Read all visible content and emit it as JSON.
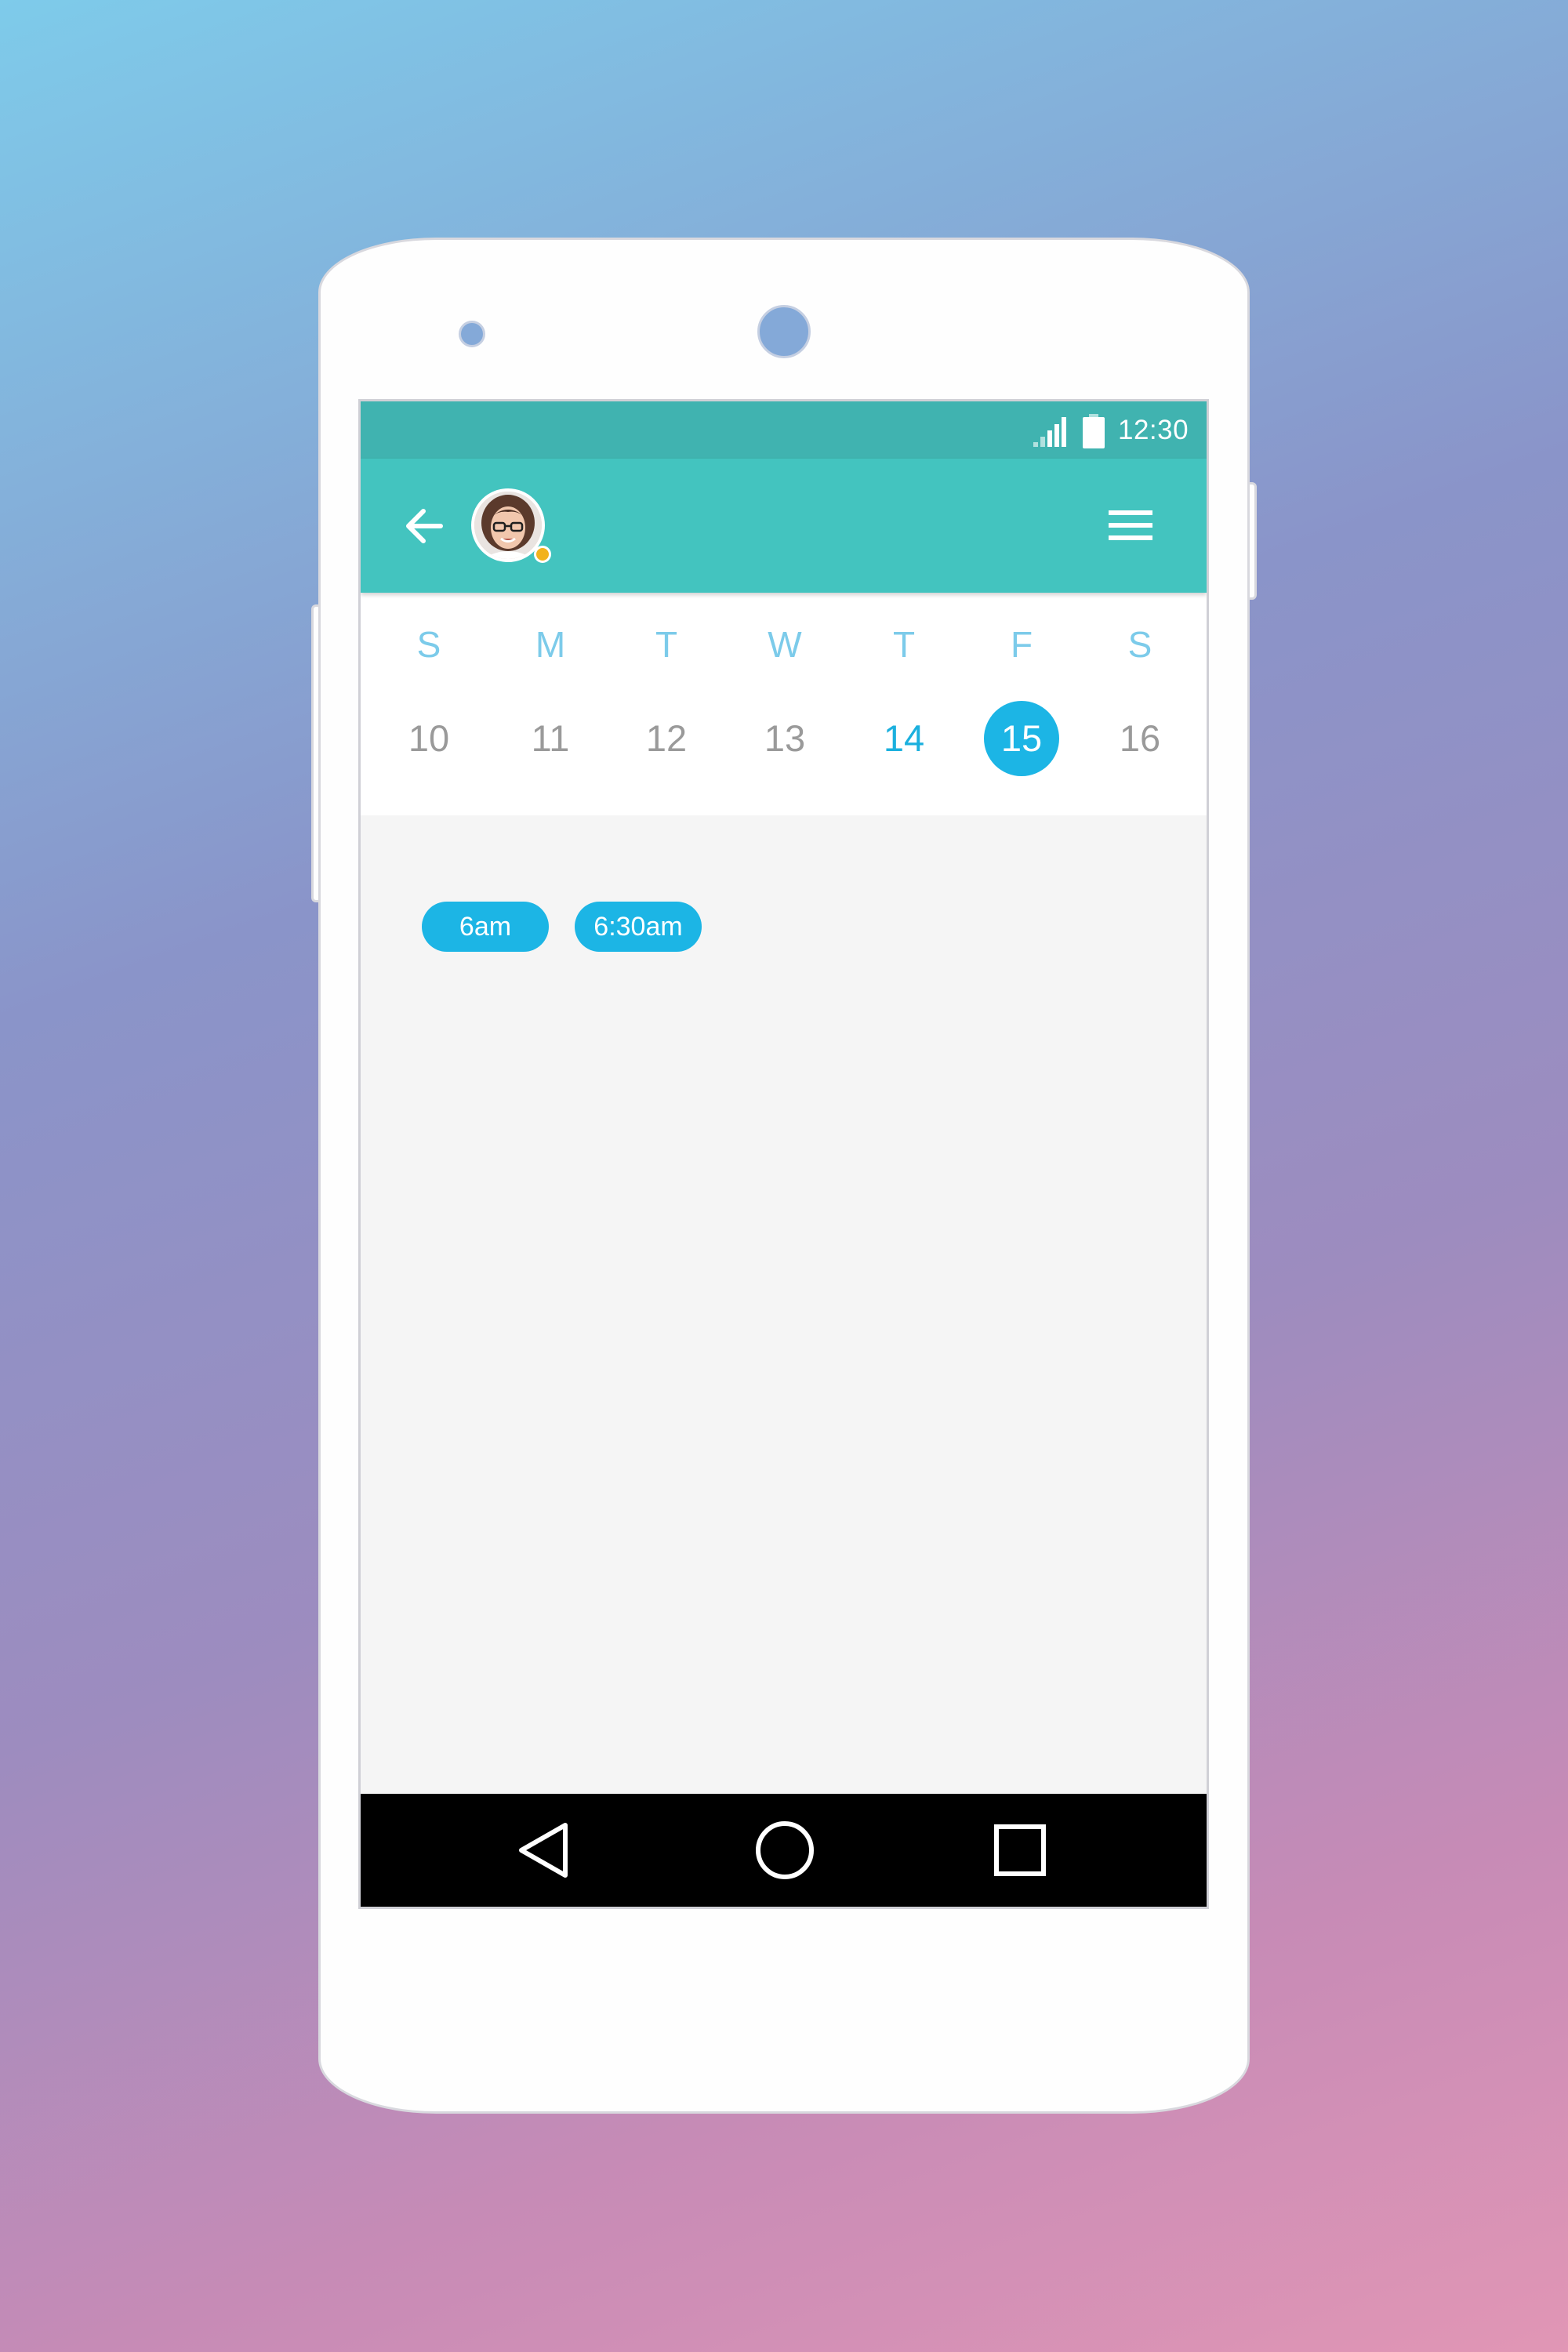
{
  "status_bar": {
    "time": "12:30",
    "signal_icon": "signal-icon",
    "battery_icon": "battery-icon"
  },
  "app_bar": {
    "back_icon": "arrow-back-icon",
    "avatar_icon": "user-avatar",
    "presence_color": "#f2b21c",
    "menu_icon": "hamburger-menu-icon",
    "color": "#43c4bf"
  },
  "week": {
    "days": [
      {
        "letter": "S",
        "date": "10"
      },
      {
        "letter": "M",
        "date": "11"
      },
      {
        "letter": "T",
        "date": "12"
      },
      {
        "letter": "W",
        "date": "13"
      },
      {
        "letter": "T",
        "date": "14"
      },
      {
        "letter": "F",
        "date": "15"
      },
      {
        "letter": "S",
        "date": "16"
      }
    ],
    "today": "14",
    "selected": "15",
    "accent_color": "#1cb5e5"
  },
  "time_slots": [
    "6am",
    "6:30am"
  ],
  "nav_bar": {
    "back_icon": "triangle-back-icon",
    "home_icon": "circle-home-icon",
    "recents_icon": "square-recents-icon"
  }
}
